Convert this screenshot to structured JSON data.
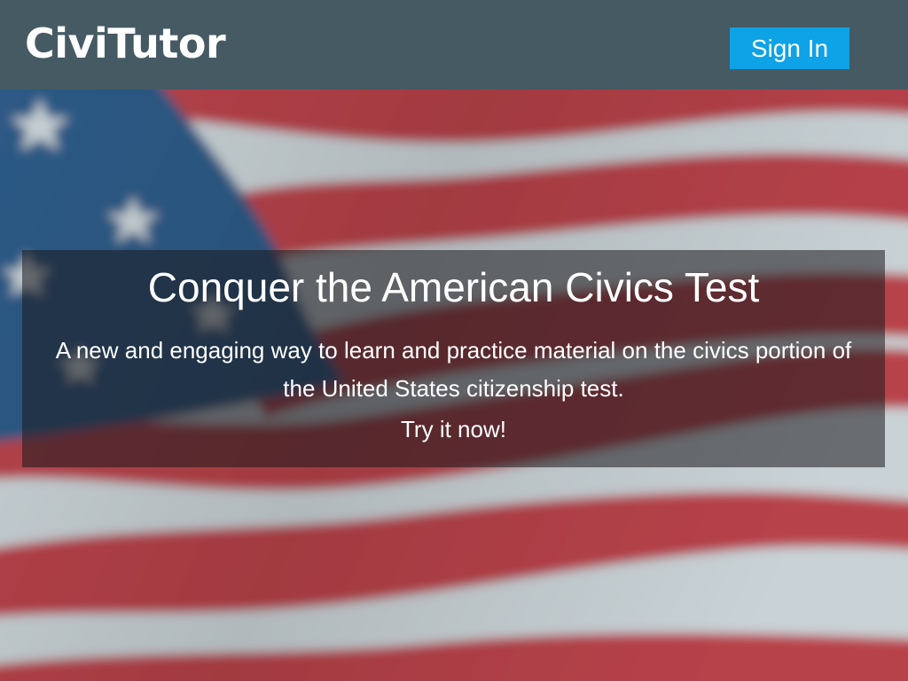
{
  "header": {
    "logo_text": "CiviTutor",
    "signin_label": "Sign In"
  },
  "hero": {
    "background": "us-flag-waving",
    "title": "Conquer the American Civics Test",
    "description": "A new and engaging way to learn and practice material on the civics portion of the United States citizenship test.",
    "cta": "Try it now!"
  },
  "colors": {
    "header_bg": "#465a63",
    "signin_bg": "#0ea2e6",
    "flag_red": "#b8424a",
    "flag_white": "#c9d2d6",
    "flag_blue": "#2d5a86"
  }
}
